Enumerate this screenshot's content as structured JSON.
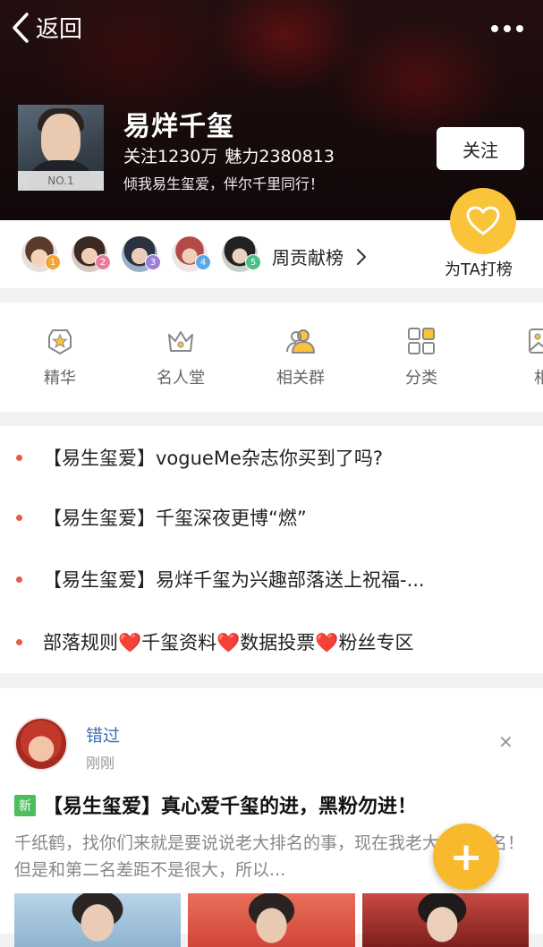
{
  "nav_bar": {
    "back_label": "返回"
  },
  "profile": {
    "rank": "NO.1",
    "name": "易烊千玺",
    "follow_count": "关注1230万",
    "charm": "魅力2380813",
    "slogan": "倾我易生玺爱，伴尔千里同行！",
    "follow_button": "关注",
    "vote_label": "为TA打榜"
  },
  "contributors": {
    "ranks": [
      "1",
      "2",
      "3",
      "4",
      "5"
    ],
    "weekly_label": "周贡献榜"
  },
  "nav_items": [
    {
      "label": "精华",
      "icon": "badge-star-icon"
    },
    {
      "label": "名人堂",
      "icon": "crown-icon"
    },
    {
      "label": "相关群",
      "icon": "group-icon"
    },
    {
      "label": "分类",
      "icon": "grid-icon"
    },
    {
      "label": "相",
      "icon": "image-icon"
    }
  ],
  "announcements": [
    "【易生玺爱】vogueMe杂志你买到了吗?",
    "【易生玺爱】千玺深夜更博“燃”",
    "【易生玺爱】易烊千玺为兴趣部落送上祝福-...",
    "部落规则❤️千玺资料❤️数据投票❤️粉丝专区"
  ],
  "post": {
    "author": "错过",
    "time": "刚刚",
    "badge": "新",
    "title": "【易生玺爱】真心爱千玺的进，黑粉勿进！",
    "body": "千纸鹤，找你们来就是要说说老大排名的事，现在我老大排第一名！但是和第二名差距不是很大，所以..."
  },
  "fab_label": "+",
  "colors": {
    "accent": "#f9c33a",
    "bullet": "#e35d4e",
    "link": "#3b6fb6",
    "new_badge": "#4cbf5c"
  }
}
